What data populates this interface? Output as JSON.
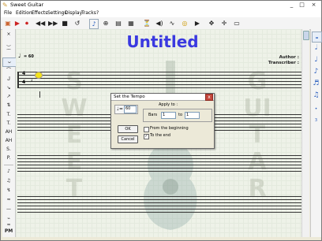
{
  "window": {
    "title": "Sweet Guitar",
    "minimize": "_",
    "maximize": "□",
    "close": "×"
  },
  "menu": [
    "File",
    "Edition",
    "Effects",
    "Settings",
    "Display",
    "Tracks",
    "?"
  ],
  "toolbar": {
    "tools": [
      "new-icon",
      "play-icon",
      "record-icon",
      "rewind-icon",
      "fast-forward-icon",
      "stop-icon",
      "loop-icon",
      "note-icon",
      "zoom-icon",
      "text-icon",
      "metronome-icon",
      "speaker-icon",
      "wave-icon",
      "tuner-icon",
      "move-icon",
      "crosshair-icon",
      "grid-icon"
    ]
  },
  "left_tools": [
    "×",
    "‿",
    "⁀",
    "ᴗ",
    "⌒",
    "ᒍ",
    "↘",
    "↗",
    "⇅",
    "T.",
    "T.",
    "AH",
    "AH",
    "S.",
    "P.",
    "♪",
    "♫",
    "↯",
    "≈",
    "—",
    "⌁",
    "≈",
    "⌄",
    "PM"
  ],
  "right_tools": [
    "whole-note-icon",
    "half-note-icon",
    "quarter-note-icon",
    "eighth-note-icon",
    "sixteenth-note-icon",
    "thirty-second-note-icon",
    "dot-icon",
    "triplet-icon"
  ],
  "score": {
    "title": "Untitled",
    "author_label": "Author :",
    "transcriber_label": "Transcriber :",
    "tempo_text": "= 60",
    "watermark_left": "SWEET",
    "watermark_right": "GUITAR",
    "tab_numbers": [
      "4",
      "4"
    ]
  },
  "dialog": {
    "title": "Set the Tempo",
    "close": "x",
    "tempo_value": "60",
    "apply_to_label": "Apply to :",
    "bars_label": "Bars",
    "bars_from": "1",
    "to_label": "to",
    "bars_to": "1",
    "from_beginning_label": "From the beginning",
    "from_beginning_checked": false,
    "to_end_label": "To the end",
    "to_end_checked": true,
    "ok_label": "OK",
    "cancel_label": "Cancel"
  },
  "colors": {
    "accent": "#3a39e0",
    "note_highlight": "#f2e31a",
    "close_red": "#c4453a"
  }
}
